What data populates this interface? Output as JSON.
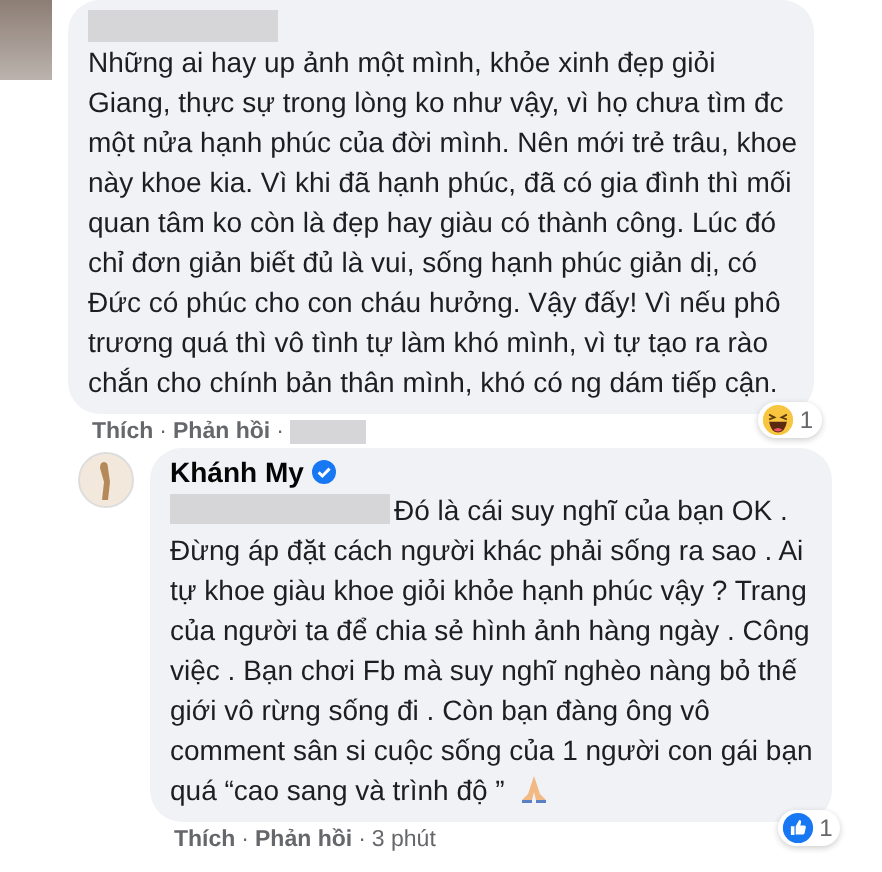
{
  "comments": [
    {
      "lines": [
        "Những ai hay up ảnh một mình, khỏe xinh đẹp giỏi",
        "Giang, thực sự trong lòng ko như vậy, vì họ chưa tìm đc",
        "một nửa hạnh phúc của đời mình. Nên mới trẻ trâu, khoe",
        "này khoe kia. Vì khi đã hạnh phúc, đã có gia đình thì mối",
        "quan tâm ko còn là đẹp hay giàu có thành công. Lúc đó",
        "chỉ đơn giản biết đủ là vui, sống hạnh phúc giản dị, có",
        "Đức có phúc cho con cháu hưởng. Vậy đấy! Vì nếu phô",
        "trương quá thì vô tình tự làm khó mình, vì tự tạo ra rào",
        "chắn cho chính bản thân mình, khó có ng dám tiếp cận."
      ],
      "reaction": {
        "kind": "haha",
        "count": "1"
      },
      "actions": [
        "Thích",
        "Phản hồi"
      ],
      "separator": "·"
    },
    {
      "author": "Khánh My",
      "verified": true,
      "lines": [
        "Đó là cái suy nghĩ của bạn OK .",
        "Đừng áp đặt cách người khác phải sống ra sao . Ai",
        "tự khoe giàu khoe giỏi khỏe hạnh phúc vậy ? Trang",
        "của người ta để chia sẻ hình ảnh hàng ngày . Công",
        "việc . Bạn chơi Fb mà suy nghĩ nghèo nàng bỏ thế",
        "giới vô rừng sống đi . Còn bạn đàng ông vô",
        "comment sân si cuộc sống của 1 người con gái bạn",
        "quá “cao sang và trình độ ”"
      ],
      "reaction": {
        "kind": "like",
        "count": "1"
      },
      "actions": [
        "Thích",
        "Phản hồi"
      ],
      "separator": "·",
      "time": "3 phút"
    }
  ]
}
